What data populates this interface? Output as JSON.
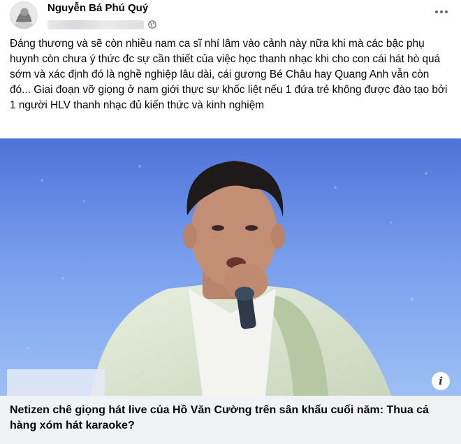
{
  "post": {
    "author": "Nguyễn Bá Phú Quý",
    "text": "Đáng thương và sẽ còn nhiều nam ca sĩ nhí lâm vào cảnh này nữa khi mà các bậc phụ huynh còn chưa ý thức đc sự cần thiết của việc học thanh nhạc khi cho con cái hát hò quá sớm và xác định đó là nghề nghiệp lâu dài, cái gương Bé Châu hay Quang Anh vẫn còn đó... Giai đoạn vỡ giọng ở nam giới thực sự khốc liệt nếu 1 đứa trẻ không được đào tạo bởi 1 người HLV thanh nhạc đủ kiến thức và kinh nghiệm"
  },
  "icons": {
    "privacy": "globe-icon",
    "menu": "more-options-icon",
    "info": "info-icon"
  },
  "info_glyph": "i",
  "link": {
    "title": "Netizen chê giọng hát live của Hồ Văn Cường trên sân khấu cuối năm: Thua cả hàng xóm hát karaoke?"
  },
  "colors": {
    "link_bar_bg": "#f0f2f5",
    "secondary_text": "#65676b",
    "stage_blue": "#6e95ef"
  }
}
